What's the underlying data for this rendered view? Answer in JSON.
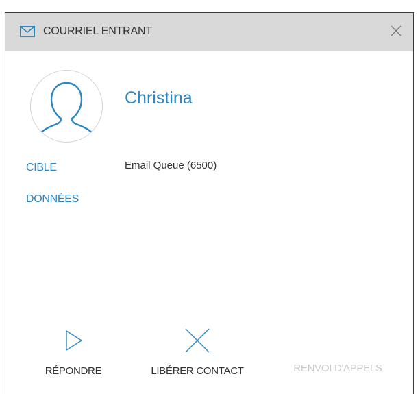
{
  "header": {
    "title": "COURRIEL ENTRANT",
    "mail_icon": "envelope-icon",
    "close_icon": "close-icon"
  },
  "contact": {
    "name": "Christina",
    "avatar_icon": "person-silhouette-icon"
  },
  "details": {
    "cible_label": "CIBLE",
    "cible_value": "Email Queue (6500)",
    "donnees_label": "DONNÉES"
  },
  "actions": {
    "repondre": {
      "label": "RÉPONDRE",
      "icon": "play-triangle-icon"
    },
    "liberer": {
      "label": "LIBÉRER CONTACT",
      "icon": "x-icon"
    },
    "renvoi": {
      "label": "RENVOI D'APPELS",
      "disabled": true
    }
  },
  "colors": {
    "accent": "#2e86c1",
    "header_bg": "#d9d9d9",
    "text": "#333333",
    "disabled": "#c9c9c9"
  }
}
